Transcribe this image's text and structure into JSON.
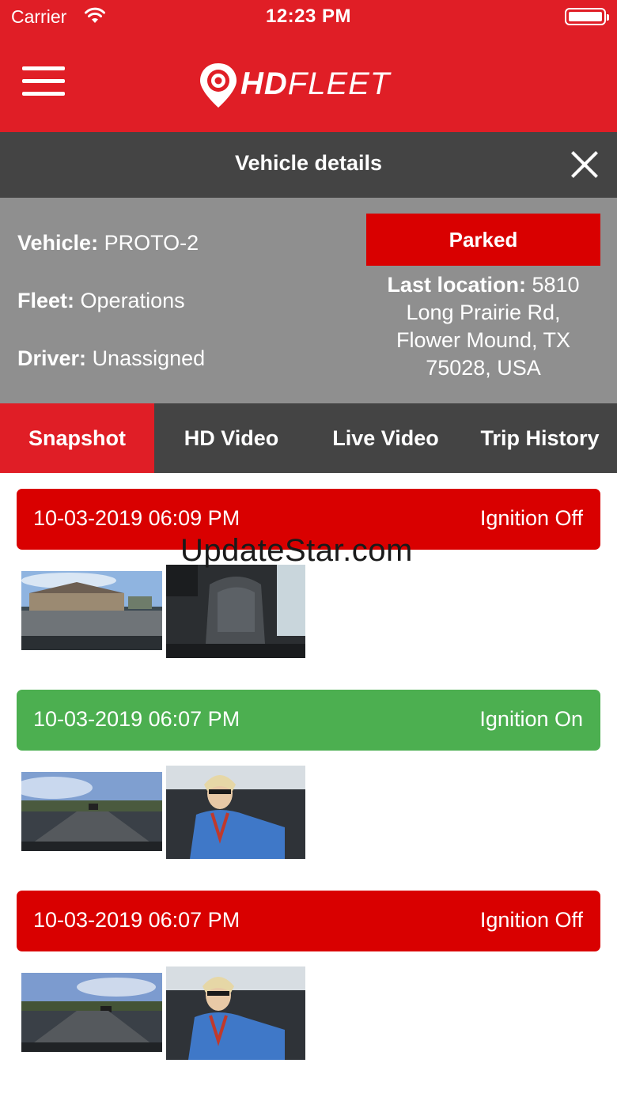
{
  "status_bar": {
    "carrier": "Carrier",
    "time": "12:23 PM"
  },
  "header": {
    "logo_bold": "HD",
    "logo_light": "FLEET"
  },
  "details_bar": {
    "title": "Vehicle details"
  },
  "vehicle": {
    "vehicle_label": "Vehicle:",
    "vehicle_value": "PROTO-2",
    "fleet_label": "Fleet:",
    "fleet_value": "Operations",
    "driver_label": "Driver:",
    "driver_value": "Unassigned",
    "status": "Parked",
    "location_label": "Last location:",
    "location_line1": "5810",
    "location_line2": "Long Prairie Rd,",
    "location_line3": "Flower Mound, TX",
    "location_line4": "75028, USA"
  },
  "tabs": [
    {
      "label": "Snapshot"
    },
    {
      "label": "HD Video"
    },
    {
      "label": "Live Video"
    },
    {
      "label": "Trip History"
    }
  ],
  "snapshots": [
    {
      "datetime": "10-03-2019 06:09 PM",
      "status": "Ignition Off"
    },
    {
      "datetime": "10-03-2019 06:07 PM",
      "status": "Ignition On"
    },
    {
      "datetime": "10-03-2019 06:07 PM",
      "status": "Ignition Off"
    }
  ],
  "watermark": "UpdateStar.com",
  "colors": {
    "brand_red": "#e01e26",
    "badge_red": "#d90000",
    "ignition_on_green": "#4caf50",
    "dark_bar": "#444444",
    "panel_gray": "#8f8f8f"
  }
}
